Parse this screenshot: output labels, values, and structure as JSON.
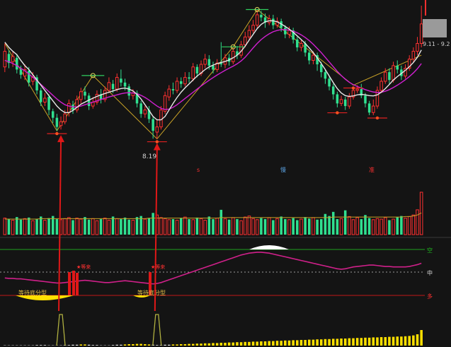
{
  "chart_data": {
    "type": "candlestick",
    "colors": {
      "up": "#ff3030",
      "down": "#30e090",
      "ma_fast": "#e8e8e8",
      "ma_slow": "#d020d0",
      "zigzag": "#c9a227",
      "arrow": "#e01818",
      "osc_line": "#d0208a",
      "osc_hi_bar": "#ffffff",
      "osc_lo_bar": "#ffe000",
      "top_rule": "#20a020",
      "mid_rule": "#9a9a9a",
      "bottom_rule": "#c01818",
      "bottom_spike": "#b0b040",
      "bottom_bars": "#ffe000"
    },
    "price_panel": {
      "ylim": [
        7.5,
        13.3
      ],
      "candles": [
        [
          10.95,
          11.55,
          11.85,
          10.75
        ],
        [
          11.45,
          11.1,
          11.6,
          10.9
        ],
        [
          11.15,
          11.35,
          11.55,
          10.95
        ],
        [
          11.3,
          10.85,
          11.45,
          10.7
        ],
        [
          10.85,
          10.65,
          11.0,
          10.5
        ],
        [
          10.6,
          10.85,
          11.05,
          10.45
        ],
        [
          10.8,
          10.35,
          10.95,
          10.2
        ],
        [
          10.4,
          10.55,
          10.75,
          10.25
        ],
        [
          10.55,
          10.05,
          10.65,
          9.9
        ],
        [
          10.05,
          9.6,
          10.15,
          9.45
        ],
        [
          9.6,
          9.75,
          9.95,
          9.45
        ],
        [
          9.8,
          9.3,
          9.9,
          9.1
        ],
        [
          9.25,
          9.0,
          9.35,
          8.8
        ],
        [
          9.0,
          8.65,
          9.15,
          8.5
        ],
        [
          8.7,
          8.85,
          9.05,
          8.55
        ],
        [
          8.85,
          9.15,
          9.3,
          8.75
        ],
        [
          9.2,
          9.55,
          9.7,
          9.05
        ],
        [
          9.5,
          9.3,
          9.65,
          9.15
        ],
        [
          9.3,
          9.7,
          9.85,
          9.2
        ],
        [
          9.7,
          10.0,
          10.15,
          9.55
        ],
        [
          10.0,
          9.85,
          10.2,
          9.7
        ],
        [
          9.85,
          9.45,
          9.95,
          9.3
        ],
        [
          9.45,
          9.6,
          9.8,
          9.35
        ],
        [
          9.6,
          9.9,
          10.05,
          9.5
        ],
        [
          9.9,
          9.7,
          10.1,
          9.55
        ],
        [
          9.7,
          10.05,
          10.2,
          9.6
        ],
        [
          10.05,
          10.35,
          10.55,
          9.95
        ],
        [
          10.3,
          10.1,
          10.45,
          9.95
        ],
        [
          10.1,
          10.55,
          10.7,
          10.0
        ],
        [
          10.5,
          10.35,
          10.85,
          10.2
        ],
        [
          10.35,
          10.2,
          10.5,
          10.05
        ],
        [
          10.2,
          9.85,
          10.3,
          9.7
        ],
        [
          9.85,
          9.95,
          10.1,
          9.7
        ],
        [
          9.95,
          9.55,
          10.05,
          9.4
        ],
        [
          9.55,
          9.15,
          9.65,
          9.0
        ],
        [
          9.15,
          9.3,
          9.45,
          9.0
        ],
        [
          9.3,
          8.95,
          9.45,
          8.8
        ],
        [
          8.95,
          8.5,
          9.05,
          8.2
        ],
        [
          8.45,
          8.65,
          8.95,
          8.19
        ],
        [
          8.65,
          9.3,
          9.45,
          8.55
        ],
        [
          9.25,
          9.85,
          10.0,
          9.15
        ],
        [
          9.8,
          10.1,
          10.25,
          9.65
        ],
        [
          10.1,
          10.05,
          10.35,
          9.9
        ],
        [
          10.05,
          10.4,
          10.55,
          9.95
        ],
        [
          10.4,
          10.3,
          10.55,
          10.15
        ],
        [
          10.3,
          10.55,
          10.75,
          10.2
        ],
        [
          10.55,
          10.5,
          10.75,
          10.35
        ],
        [
          10.5,
          10.95,
          11.1,
          10.4
        ],
        [
          10.95,
          10.7,
          11.05,
          10.55
        ],
        [
          10.7,
          11.05,
          11.2,
          10.6
        ],
        [
          11.05,
          11.25,
          11.45,
          10.9
        ],
        [
          11.25,
          11.0,
          11.4,
          10.85
        ],
        [
          11.0,
          10.85,
          11.15,
          10.7
        ],
        [
          10.85,
          11.1,
          11.25,
          10.75
        ],
        [
          11.1,
          11.05,
          11.9,
          10.95
        ],
        [
          11.05,
          11.3,
          11.45,
          10.9
        ],
        [
          11.3,
          11.15,
          11.45,
          11.0
        ],
        [
          11.15,
          11.55,
          11.7,
          11.05
        ],
        [
          11.55,
          11.4,
          11.75,
          11.25
        ],
        [
          11.4,
          11.8,
          11.95,
          11.3
        ],
        [
          11.8,
          12.1,
          12.3,
          11.7
        ],
        [
          12.1,
          12.35,
          12.55,
          12.0
        ],
        [
          12.35,
          12.55,
          12.75,
          12.25
        ],
        [
          12.55,
          12.95,
          13.15,
          12.45
        ],
        [
          12.95,
          12.85,
          13.1,
          12.7
        ],
        [
          12.85,
          12.65,
          13.0,
          12.45
        ],
        [
          12.65,
          12.8,
          12.95,
          12.55
        ],
        [
          12.8,
          12.55,
          12.95,
          12.4
        ],
        [
          12.55,
          12.7,
          12.85,
          12.45
        ],
        [
          12.7,
          12.45,
          12.8,
          12.3
        ],
        [
          12.45,
          12.2,
          12.55,
          12.05
        ],
        [
          12.2,
          12.35,
          12.5,
          12.05
        ],
        [
          12.35,
          12.0,
          12.45,
          11.85
        ],
        [
          12.0,
          11.7,
          12.1,
          11.55
        ],
        [
          11.7,
          11.85,
          12.0,
          11.55
        ],
        [
          11.85,
          11.5,
          11.95,
          11.35
        ],
        [
          11.5,
          11.2,
          11.6,
          11.05
        ],
        [
          11.2,
          11.4,
          11.55,
          11.05
        ],
        [
          11.4,
          11.05,
          11.5,
          10.8
        ],
        [
          11.05,
          10.75,
          11.15,
          10.55
        ],
        [
          10.75,
          10.5,
          10.85,
          10.3
        ],
        [
          10.5,
          10.2,
          10.6,
          10.05
        ],
        [
          10.2,
          9.9,
          10.3,
          9.7
        ],
        [
          9.9,
          9.55,
          10.0,
          9.4
        ],
        [
          9.55,
          9.7,
          9.85,
          9.45
        ],
        [
          9.7,
          9.45,
          9.8,
          9.3
        ],
        [
          9.45,
          9.8,
          9.95,
          9.35
        ],
        [
          9.8,
          10.05,
          10.2,
          9.7
        ],
        [
          10.05,
          10.1,
          10.25,
          9.95
        ],
        [
          10.1,
          9.85,
          10.3,
          9.75
        ],
        [
          9.85,
          9.55,
          9.95,
          9.4
        ],
        [
          9.55,
          9.2,
          9.65,
          9.1
        ],
        [
          9.2,
          9.45,
          9.7,
          9.1
        ],
        [
          9.45,
          10.05,
          10.2,
          9.35
        ],
        [
          10.05,
          10.4,
          10.55,
          9.95
        ],
        [
          10.4,
          10.75,
          10.9,
          10.3
        ],
        [
          10.75,
          10.45,
          10.9,
          10.3
        ],
        [
          10.45,
          11.0,
          11.15,
          10.35
        ],
        [
          11.0,
          10.85,
          11.2,
          10.7
        ],
        [
          10.85,
          10.6,
          11.0,
          10.45
        ],
        [
          10.6,
          10.9,
          11.05,
          10.5
        ],
        [
          10.9,
          11.25,
          11.4,
          10.8
        ],
        [
          11.25,
          11.55,
          11.7,
          11.1
        ],
        [
          11.55,
          11.85,
          12.1,
          11.4
        ],
        [
          11.85,
          12.6,
          13.3,
          11.7
        ]
      ],
      "ma_fast": [
        11.9,
        11.7,
        11.55,
        11.42,
        11.2,
        11.0,
        10.85,
        10.65,
        10.45,
        10.25,
        10.05,
        9.85,
        9.65,
        9.45,
        9.3,
        9.2,
        9.2,
        9.28,
        9.4,
        9.52,
        9.6,
        9.68,
        9.75,
        9.82,
        9.88,
        9.93,
        9.98,
        10.03,
        10.08,
        10.12,
        10.14,
        10.1,
        10.03,
        9.9,
        9.72,
        9.5,
        9.28,
        9.05,
        8.92,
        8.92,
        9.05,
        9.3,
        9.55,
        9.78,
        9.98,
        10.15,
        10.3,
        10.45,
        10.6,
        10.72,
        10.85,
        10.95,
        11.02,
        11.08,
        11.12,
        11.16,
        11.22,
        11.3,
        11.4,
        11.55,
        11.75,
        11.98,
        12.2,
        12.42,
        12.58,
        12.68,
        12.72,
        12.72,
        12.68,
        12.6,
        12.5,
        12.4,
        12.28,
        12.14,
        12.0,
        11.85,
        11.68,
        11.5,
        11.3,
        11.08,
        10.85,
        10.6,
        10.35,
        10.12,
        9.95,
        9.85,
        9.82,
        9.84,
        9.88,
        9.9,
        9.88,
        9.85,
        9.84,
        9.88,
        9.98,
        10.12,
        10.28,
        10.45,
        10.58,
        10.7,
        10.82,
        10.96,
        11.12,
        11.32,
        11.6
      ],
      "ma_slow": [
        11.2,
        11.15,
        11.08,
        11.0,
        10.9,
        10.8,
        10.68,
        10.55,
        10.42,
        10.28,
        10.14,
        10.0,
        9.86,
        9.72,
        9.6,
        9.5,
        9.45,
        9.42,
        9.42,
        9.45,
        9.5,
        9.55,
        9.6,
        9.65,
        9.7,
        9.75,
        9.8,
        9.84,
        9.88,
        9.92,
        9.95,
        9.96,
        9.95,
        9.92,
        9.86,
        9.78,
        9.68,
        9.56,
        9.45,
        9.36,
        9.32,
        9.33,
        9.4,
        9.5,
        9.62,
        9.74,
        9.86,
        9.98,
        10.1,
        10.22,
        10.33,
        10.44,
        10.54,
        10.64,
        10.73,
        10.82,
        10.9,
        10.98,
        11.07,
        11.18,
        11.32,
        11.5,
        11.68,
        11.85,
        12.0,
        12.12,
        12.22,
        12.3,
        12.35,
        12.38,
        12.38,
        12.36,
        12.32,
        12.26,
        12.18,
        12.08,
        11.96,
        11.82,
        11.66,
        11.5,
        11.32,
        11.14,
        10.96,
        10.78,
        10.62,
        10.48,
        10.36,
        10.27,
        10.2,
        10.14,
        10.08,
        10.03,
        9.99,
        9.97,
        9.98,
        10.02,
        10.08,
        10.16,
        10.25,
        10.35,
        10.46,
        10.58,
        10.72,
        10.88,
        11.08
      ],
      "zigzag": [
        [
          0,
          11.85
        ],
        [
          13,
          8.5
        ],
        [
          22,
          10.62
        ],
        [
          38,
          8.19
        ],
        [
          57,
          11.72
        ],
        [
          63,
          13.15
        ],
        [
          87,
          10.25
        ],
        [
          104,
          11.4
        ]
      ],
      "price_label": "8.19",
      "axis_badge": "9.11 - 9.2",
      "status_marks": [
        {
          "text": "s",
          "color": "#ff3030"
        },
        {
          "text": "慢",
          "color": "#5aa0e0"
        },
        {
          "text": "准",
          "color": "#ff3030"
        }
      ]
    },
    "volume_panel": {
      "values": [
        32,
        30,
        28,
        34,
        29,
        31,
        33,
        27,
        30,
        35,
        28,
        32,
        36,
        30,
        29,
        31,
        33,
        28,
        32,
        30,
        34,
        29,
        31,
        27,
        30,
        32,
        28,
        35,
        31,
        30,
        33,
        29,
        28,
        34,
        36,
        30,
        32,
        42,
        38,
        33,
        31,
        29,
        30,
        28,
        32,
        34,
        30,
        29,
        33,
        31,
        28,
        35,
        30,
        32,
        48,
        31,
        29,
        33,
        30,
        27,
        34,
        36,
        31,
        29,
        32,
        30,
        33,
        28,
        31,
        35,
        30,
        29,
        32,
        28,
        30,
        34,
        31,
        33,
        29,
        30,
        40,
        36,
        44,
        30,
        31,
        47,
        35,
        29,
        33,
        30,
        38,
        32,
        29,
        31,
        30,
        33,
        28,
        30,
        34,
        36,
        32,
        35,
        38,
        48,
        82
      ],
      "avg": [
        30,
        30,
        30,
        30,
        30,
        30,
        30,
        30,
        30,
        31,
        31,
        31,
        31,
        31,
        31,
        31,
        31,
        31,
        31,
        31,
        31,
        31,
        31,
        31,
        31,
        31,
        31,
        31,
        31,
        31,
        31,
        31,
        31,
        31,
        31,
        31,
        32,
        32,
        32,
        32,
        32,
        32,
        32,
        32,
        32,
        32,
        32,
        32,
        32,
        32,
        32,
        32,
        32,
        32,
        33,
        33,
        33,
        33,
        33,
        33,
        33,
        33,
        33,
        33,
        33,
        33,
        33,
        33,
        33,
        33,
        33,
        33,
        33,
        33,
        33,
        33,
        33,
        33,
        33,
        33,
        33,
        33,
        34,
        34,
        34,
        34,
        34,
        34,
        34,
        34,
        34,
        34,
        34,
        34,
        34,
        34,
        34,
        34,
        34,
        34,
        35,
        35,
        36,
        38,
        42
      ]
    },
    "oscillator_panel": {
      "ylim": [
        0,
        100
      ],
      "line": [
        38,
        37,
        37,
        36,
        36,
        35,
        34,
        33,
        32,
        31,
        30,
        29,
        28,
        27,
        27,
        28,
        29,
        30,
        31,
        32,
        33,
        32,
        31,
        30,
        29,
        28,
        28,
        29,
        30,
        31,
        32,
        31,
        30,
        29,
        28,
        27,
        26,
        25,
        26,
        28,
        31,
        34,
        37,
        40,
        43,
        46,
        49,
        52,
        55,
        58,
        61,
        64,
        67,
        70,
        73,
        76,
        79,
        82,
        85,
        88,
        90,
        92,
        93,
        94,
        94,
        93,
        92,
        90,
        88,
        86,
        84,
        82,
        80,
        78,
        76,
        74,
        72,
        70,
        68,
        66,
        64,
        62,
        60,
        58,
        57,
        58,
        60,
        62,
        63,
        64,
        65,
        66,
        66,
        65,
        64,
        63,
        63,
        62,
        62,
        62,
        62,
        63,
        65,
        67,
        70
      ],
      "rules": [
        {
          "label": "空",
          "value": 100
        },
        {
          "label": "中",
          "value": 60
        },
        {
          "label": "多",
          "value": 0
        }
      ],
      "wait_labels": [
        "等待底分型",
        "等待底分型"
      ],
      "star_labels": [
        "★等来",
        "★等来"
      ]
    },
    "bottom_panel": {
      "spikes_at": [
        14,
        38
      ],
      "bars": [
        1,
        1,
        1,
        1,
        1,
        1,
        1,
        1,
        2,
        2,
        2,
        1,
        1,
        1,
        1,
        2,
        2,
        3,
        3,
        4,
        4,
        3,
        2,
        2,
        1,
        1,
        1,
        2,
        3,
        3,
        4,
        5,
        5,
        6,
        6,
        5,
        4,
        3,
        2,
        2,
        3,
        3,
        4,
        4,
        5,
        5,
        6,
        6,
        7,
        7,
        8,
        8,
        9,
        9,
        10,
        10,
        11,
        11,
        12,
        12,
        13,
        13,
        14,
        14,
        15,
        15,
        16,
        16,
        17,
        17,
        18,
        18,
        19,
        19,
        20,
        20,
        21,
        21,
        22,
        22,
        23,
        23,
        24,
        24,
        25,
        25,
        26,
        26,
        27,
        27,
        28,
        28,
        29,
        29,
        30,
        30,
        31,
        31,
        32,
        32,
        33,
        34,
        36,
        40,
        55
      ]
    }
  }
}
